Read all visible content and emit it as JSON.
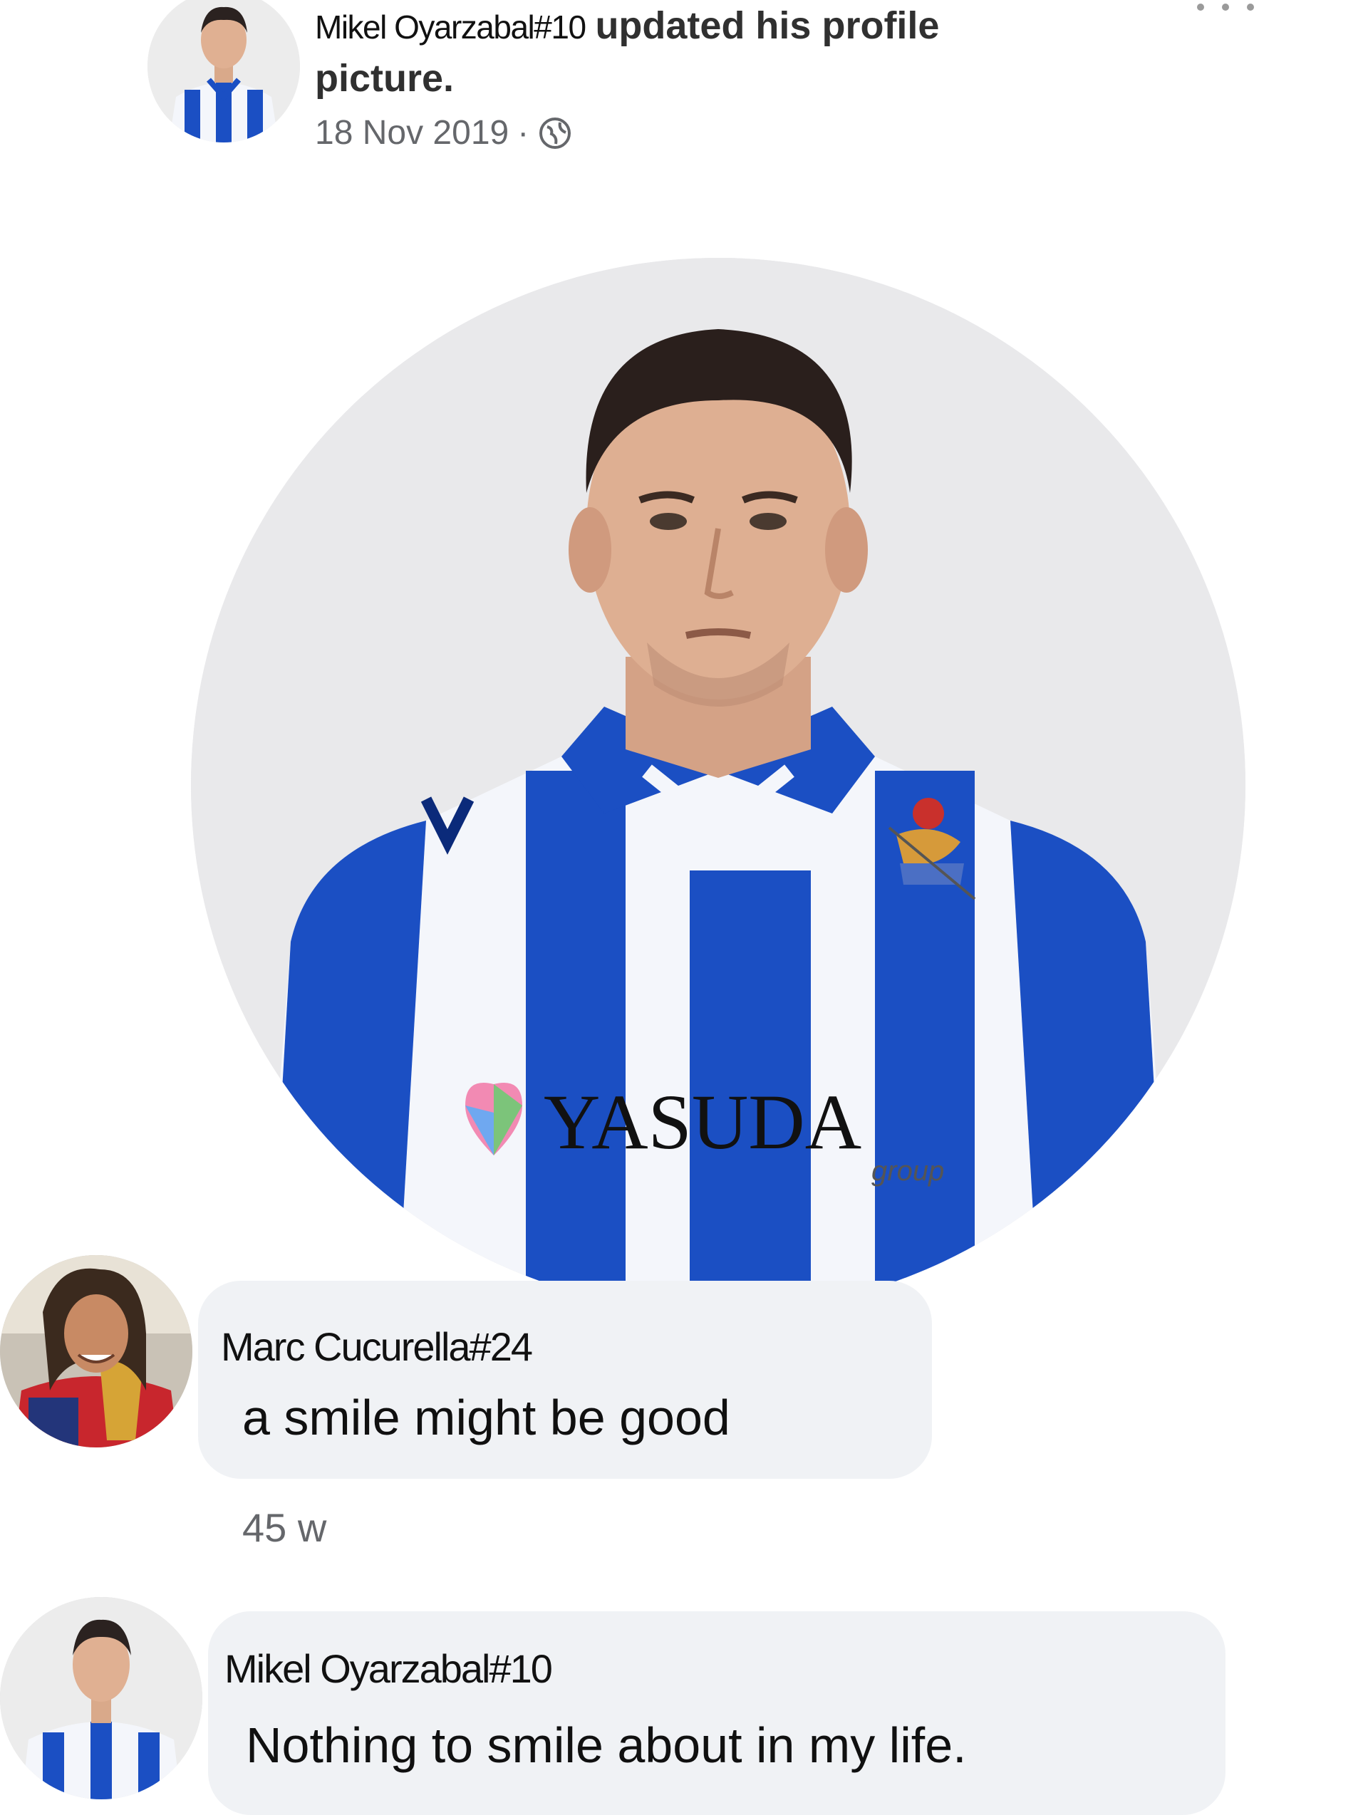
{
  "post": {
    "author": "Mikel Oyarzabal#10",
    "action_line1": "updated his profile",
    "action_line2": "picture.",
    "date": "18 Nov 2019",
    "separator": "·",
    "privacy_icon": "globe-icon",
    "more_icon": "ellipsis-icon"
  },
  "profile_photo": {
    "shirt_sponsor": "YASUDA",
    "sponsor_sub": "group",
    "colors": {
      "blue": "#1b4fc3",
      "white": "#f4f6fb",
      "background": "#e9e9eb"
    }
  },
  "comments": [
    {
      "author": "Marc Cucurella#24",
      "text": "a smile might be good",
      "time": "45 w"
    },
    {
      "author": "Mikel Oyarzabal#10",
      "text": "Nothing to smile about in my life."
    }
  ],
  "colors": {
    "bubble": "#f0f2f5",
    "meta_text": "#65676b"
  }
}
